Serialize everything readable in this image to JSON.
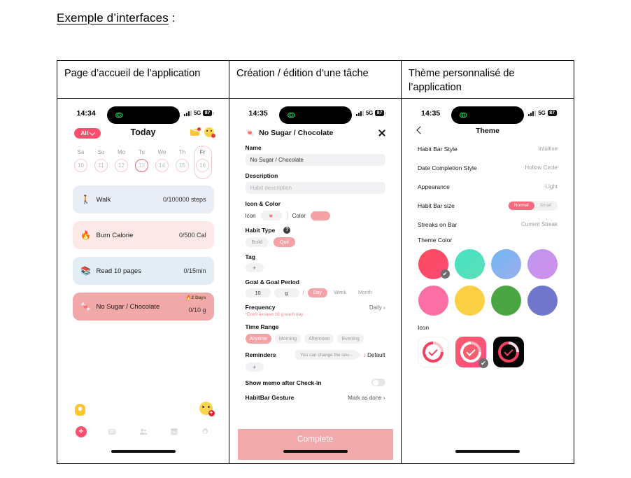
{
  "document": {
    "heading": "Exemple d’interfaces",
    "heading_suffix": " :"
  },
  "columns": [
    {
      "header": "Page d’accueil de l’application"
    },
    {
      "header": "Création / édition d’une tâche"
    },
    {
      "header": "Thème personnalisé de l’application"
    }
  ],
  "phone1": {
    "status": {
      "time": "14:34",
      "network": "5G",
      "battery": "87"
    },
    "topbar": {
      "filter": "All",
      "title": "Today",
      "mail_icon": "mail-icon",
      "profile_icon": "profile-face-icon"
    },
    "week": {
      "days": [
        {
          "dow": "Sa",
          "num": "10",
          "state": "normal"
        },
        {
          "dow": "Su",
          "num": "11",
          "state": "normal"
        },
        {
          "dow": "Mo",
          "num": "12",
          "state": "normal"
        },
        {
          "dow": "Tu",
          "num": "13",
          "state": "today"
        },
        {
          "dow": "We",
          "num": "14",
          "state": "normal"
        },
        {
          "dow": "Th",
          "num": "15",
          "state": "normal"
        },
        {
          "dow": "Fr",
          "num": "16",
          "state": "selected"
        }
      ]
    },
    "habits": [
      {
        "emoji": "🚶",
        "name": "Walk",
        "value": "0/100000 steps",
        "bg": "#E9EDF6",
        "streak": ""
      },
      {
        "emoji": "🔥",
        "name": "Burn Calorie",
        "value": "0/500 Cal",
        "bg": "#FCE8E6",
        "streak": ""
      },
      {
        "emoji": "📚",
        "name": "Read 10 pages",
        "value": "0/15min",
        "bg": "#E2EDF5",
        "streak": ""
      },
      {
        "emoji": "🍬",
        "name": "No Sugar / Chocolate",
        "value": "0/10 g",
        "bg": "#F0A8A8",
        "streak": "🔥2 Days"
      }
    ],
    "bottom": {
      "bulb_icon": "lightbulb-icon",
      "face_add_icon": "add-friend-face-icon",
      "tabs": [
        {
          "icon": "add-icon",
          "label": "+"
        },
        {
          "icon": "notes-icon",
          "label": ""
        },
        {
          "icon": "friends-icon",
          "label": ""
        },
        {
          "icon": "archive-icon",
          "label": ""
        },
        {
          "icon": "settings-gear-icon",
          "label": ""
        }
      ]
    }
  },
  "phone2": {
    "status": {
      "time": "14:35",
      "network": "5G",
      "battery": "87"
    },
    "header": {
      "emoji": "🍬",
      "title": "No Sugar / Chocolate",
      "close": "close-icon"
    },
    "fields": {
      "name_label": "Name",
      "name_value": "No Sugar / Chocolate",
      "description_label": "Description",
      "description_placeholder": "Habit description",
      "icon_color_label": "Icon & Color",
      "icon_label": "Icon",
      "icon_value": "🍬",
      "color_label": "Color",
      "color_value": "#F4A2A6",
      "habit_type_label": "Habit Type",
      "habit_type_options": [
        {
          "label": "Build",
          "selected": false
        },
        {
          "label": "Quit",
          "selected": true
        }
      ],
      "tag_label": "Tag",
      "tag_add": "+",
      "goal_label": "Goal & Goal Period",
      "goal_amount": "10",
      "goal_unit": "g",
      "goal_sep": "/",
      "goal_periods": [
        {
          "label": "Day",
          "selected": true
        },
        {
          "label": "Week",
          "selected": false
        },
        {
          "label": "Month",
          "selected": false
        }
      ],
      "frequency_label": "Frequency",
      "frequency_value": "Daily ›",
      "frequency_hint": "*Don't exceed 10 g each day",
      "time_range_label": "Time Range",
      "time_range_options": [
        {
          "label": "Anytime",
          "selected": true
        },
        {
          "label": "Morning",
          "selected": false
        },
        {
          "label": "Afternoon",
          "selected": false
        },
        {
          "label": "Evening",
          "selected": false
        }
      ],
      "reminders_label": "Reminders",
      "reminders_tooltip": "You can change the sou...",
      "reminders_default": "Default",
      "reminders_add": "+",
      "memo_label": "Show memo after Check-in",
      "gesture_label": "HabitBar Gesture",
      "gesture_value": "Mark as done ›"
    },
    "complete_button": "Complete"
  },
  "phone3": {
    "status": {
      "time": "14:35",
      "network": "5G",
      "battery": "87"
    },
    "header": {
      "back": "back-chevron-icon",
      "title": "Theme"
    },
    "settings": [
      {
        "label": "Habit Bar Style",
        "value": "Intuitive",
        "type": "value"
      },
      {
        "label": "Date Completion Style",
        "value": "Hollow Circle",
        "type": "value"
      },
      {
        "label": "Appearance",
        "value": "Light",
        "type": "value"
      },
      {
        "label": "Habit Bar size",
        "value": "",
        "type": "segment",
        "options": [
          {
            "label": "Normal",
            "selected": true
          },
          {
            "label": "Small",
            "selected": false
          }
        ]
      },
      {
        "label": "Streaks on Bar",
        "value": "Current Streak",
        "type": "value"
      }
    ],
    "theme_color_label": "Theme Color",
    "theme_colors": [
      {
        "hex": "#FB4A5F",
        "selected": true
      },
      {
        "hex": "#4EE0C1",
        "selected": false
      },
      {
        "hex": "#7FB4F0",
        "selected": false
      },
      {
        "hex": "#C193EE",
        "selected": false
      },
      {
        "hex": "#FB6FA5",
        "selected": false
      },
      {
        "hex": "#FBD043",
        "selected": false
      },
      {
        "hex": "#4CA543",
        "selected": false
      },
      {
        "hex": "#6F76CB",
        "selected": false
      }
    ],
    "icon_label": "Icon",
    "app_icons": [
      {
        "bg": "#FFFFFF",
        "selected": false,
        "style": "light"
      },
      {
        "bg": "#FB5C6E",
        "selected": true,
        "style": "pink"
      },
      {
        "bg": "#050505",
        "selected": false,
        "style": "dark"
      }
    ]
  }
}
